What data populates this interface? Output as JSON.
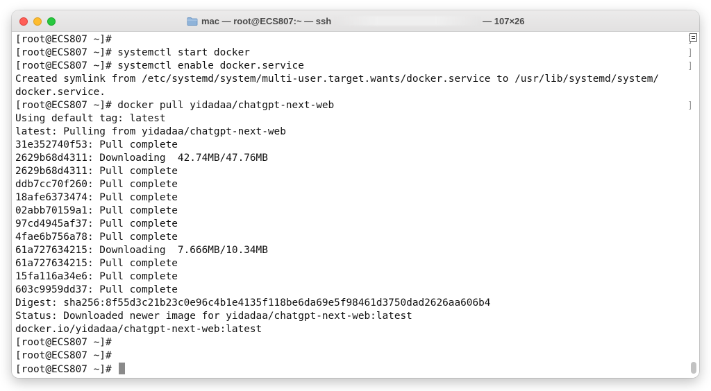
{
  "window": {
    "title": "mac — root@ECS807:~ — ssh",
    "dimensions": "— 107×26"
  },
  "terminal": {
    "lines": [
      {
        "text": "[root@ECS807 ~]#",
        "mark": "]"
      },
      {
        "text": "[root@ECS807 ~]# systemctl start docker",
        "mark": "]"
      },
      {
        "text": "[root@ECS807 ~]# systemctl enable docker.service",
        "mark": "]"
      },
      {
        "text": "Created symlink from /etc/systemd/system/multi-user.target.wants/docker.service to /usr/lib/systemd/system/",
        "mark": ""
      },
      {
        "text": "docker.service.",
        "mark": ""
      },
      {
        "text": "[root@ECS807 ~]# docker pull yidadaa/chatgpt-next-web",
        "mark": "]"
      },
      {
        "text": "Using default tag: latest",
        "mark": ""
      },
      {
        "text": "latest: Pulling from yidadaa/chatgpt-next-web",
        "mark": ""
      },
      {
        "text": "31e352740f53: Pull complete",
        "mark": ""
      },
      {
        "text": "2629b68d4311: Downloading  42.74MB/47.76MB",
        "mark": ""
      },
      {
        "text": "2629b68d4311: Pull complete",
        "mark": ""
      },
      {
        "text": "ddb7cc70f260: Pull complete",
        "mark": ""
      },
      {
        "text": "18afe6373474: Pull complete",
        "mark": ""
      },
      {
        "text": "02abb70159a1: Pull complete",
        "mark": ""
      },
      {
        "text": "97cd4945af37: Pull complete",
        "mark": ""
      },
      {
        "text": "4fae6b756a78: Pull complete",
        "mark": ""
      },
      {
        "text": "61a727634215: Downloading  7.666MB/10.34MB",
        "mark": ""
      },
      {
        "text": "61a727634215: Pull complete",
        "mark": ""
      },
      {
        "text": "15fa116a34e6: Pull complete",
        "mark": ""
      },
      {
        "text": "603c9959dd37: Pull complete",
        "mark": ""
      },
      {
        "text": "Digest: sha256:8f55d3c21b23c0e96c4b1e4135f118be6da69e5f98461d3750dad2626aa606b4",
        "mark": ""
      },
      {
        "text": "Status: Downloaded newer image for yidadaa/chatgpt-next-web:latest",
        "mark": ""
      },
      {
        "text": "docker.io/yidadaa/chatgpt-next-web:latest",
        "mark": ""
      },
      {
        "text": "[root@ECS807 ~]#",
        "mark": ""
      },
      {
        "text": "[root@ECS807 ~]#",
        "mark": ""
      },
      {
        "text": "[root@ECS807 ~]# ",
        "mark": ""
      }
    ]
  },
  "icons": {
    "close": "close-button",
    "minimize": "minimize-button",
    "zoom": "zoom-button",
    "folder": "folder-icon",
    "marker": "scroll-marker-icon"
  },
  "colors": {
    "close": "#ff5f57",
    "minimize": "#febc2e",
    "zoom": "#28c840",
    "cursor": "#8a8a8a",
    "text": "#111111"
  }
}
